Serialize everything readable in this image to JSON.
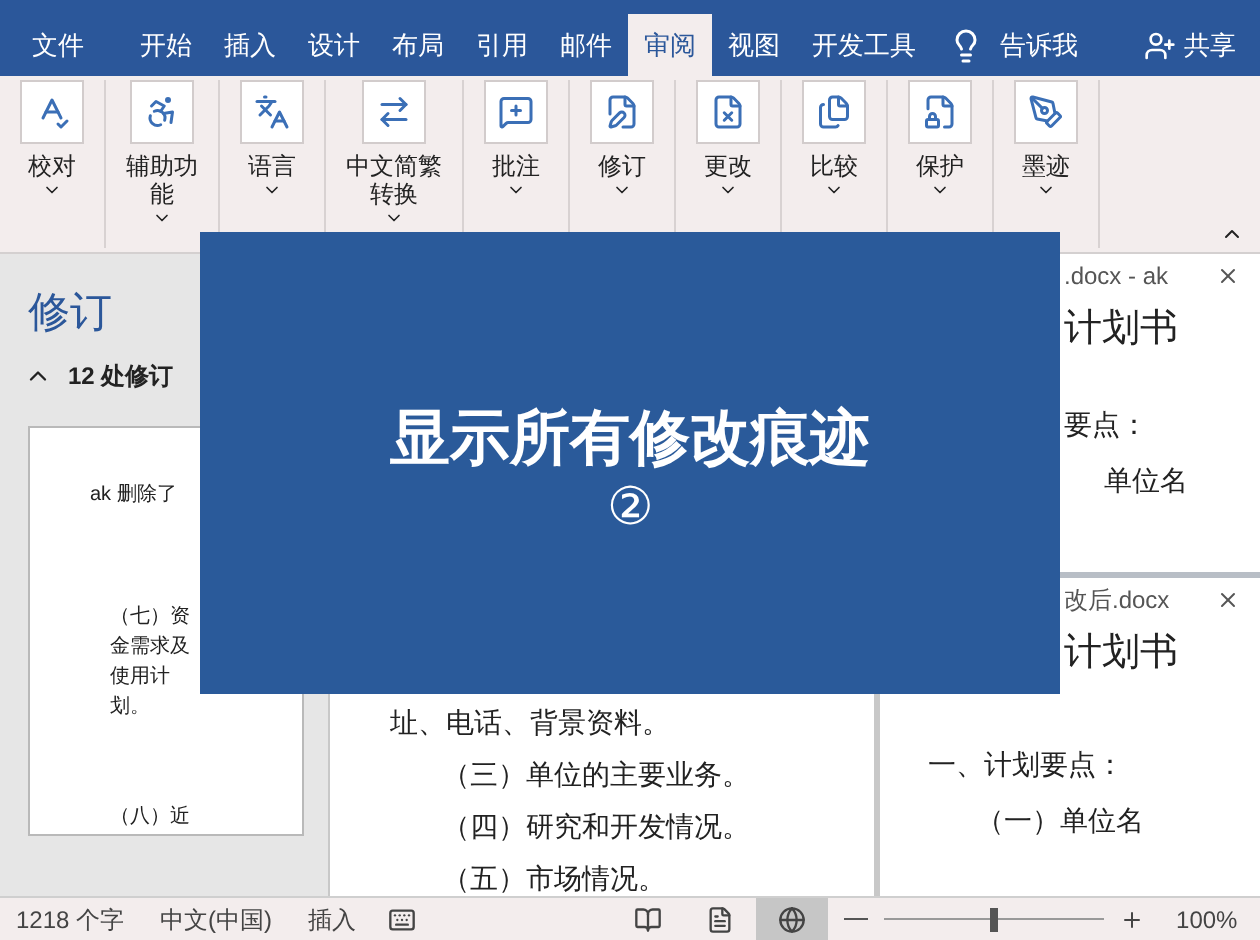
{
  "menu_tabs": [
    {
      "label": "文件",
      "selected": false
    },
    {
      "label": "开始",
      "selected": false
    },
    {
      "label": "插入",
      "selected": false
    },
    {
      "label": "设计",
      "selected": false
    },
    {
      "label": "布局",
      "selected": false
    },
    {
      "label": "引用",
      "selected": false
    },
    {
      "label": "邮件",
      "selected": false
    },
    {
      "label": "审阅",
      "selected": true
    },
    {
      "label": "视图",
      "selected": false
    },
    {
      "label": "开发工具",
      "selected": false
    }
  ],
  "tell_me": "告诉我",
  "share": "共享",
  "ribbon_groups": [
    {
      "kind": "proofing",
      "lines": [
        "校对"
      ]
    },
    {
      "kind": "accessibility",
      "lines": [
        "辅助功",
        "能"
      ]
    },
    {
      "kind": "language",
      "lines": [
        "语言"
      ]
    },
    {
      "kind": "convert",
      "lines": [
        "中文简繁",
        "转换"
      ]
    },
    {
      "kind": "comment",
      "lines": [
        "批注"
      ]
    },
    {
      "kind": "track",
      "lines": [
        "修订"
      ]
    },
    {
      "kind": "changes",
      "lines": [
        "更改"
      ]
    },
    {
      "kind": "compare",
      "lines": [
        "比较"
      ]
    },
    {
      "kind": "protect",
      "lines": [
        "保护"
      ]
    },
    {
      "kind": "ink",
      "lines": [
        "墨迹"
      ]
    }
  ],
  "revision_pane": {
    "title": "修订",
    "count": "12 处修订",
    "card_lines": [
      "ak 删除了",
      "（七）资",
      "金需求及",
      "使用计",
      "划。",
      "（八）近"
    ]
  },
  "document_lines": [
    "址、电话、背景资料。",
    "（三）单位的主要业务。",
    "（四）研究和开发情况。",
    "（五）市场情况。"
  ],
  "compare_panes": [
    {
      "title": ".docx - ak",
      "heading": "计划书",
      "lines": [
        "要点：",
        "单位名"
      ]
    },
    {
      "title": "改后.docx",
      "heading": "计划书",
      "lines": [
        "一、计划要点：",
        "（一）单位名"
      ]
    }
  ],
  "overlay": {
    "title": "显示所有修改痕迹",
    "number": "②"
  },
  "status_bar": {
    "word_count": "1218 个字",
    "language": "中文(中国)",
    "mode": "插入",
    "views": [
      {
        "kind": "read",
        "selected": false
      },
      {
        "kind": "print",
        "selected": false
      },
      {
        "kind": "web",
        "selected": true
      }
    ],
    "zoom": {
      "level": 0.5,
      "reading": "100%"
    }
  }
}
